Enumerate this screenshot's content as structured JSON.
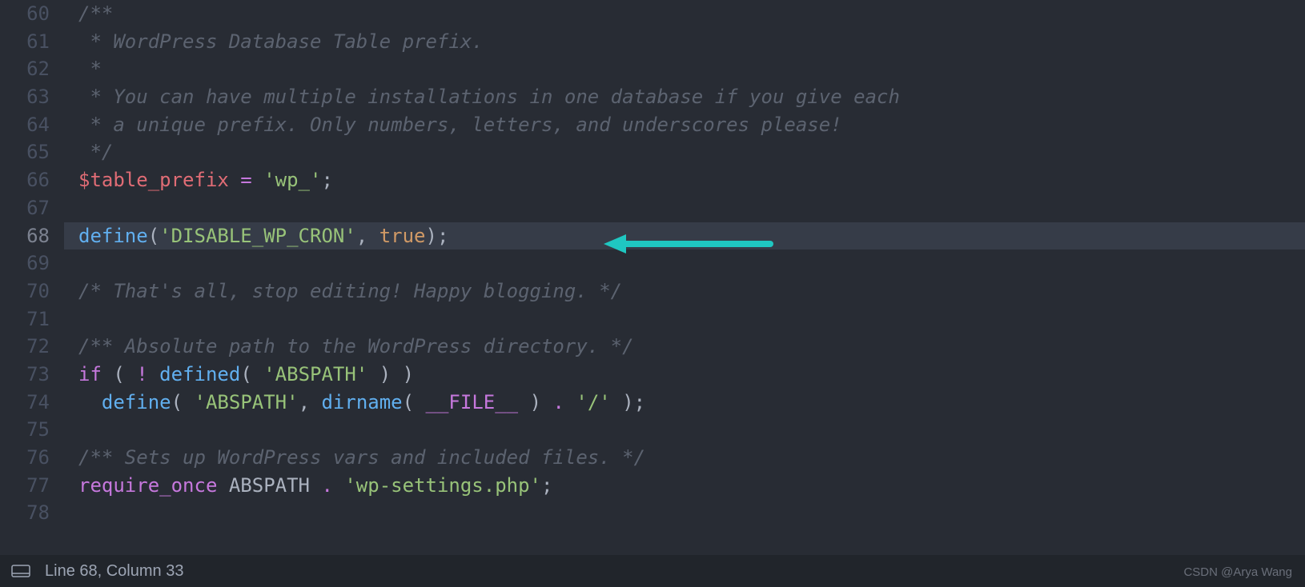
{
  "lines": [
    {
      "num": "60",
      "tokens": [
        {
          "cls": "comment",
          "text": "/**"
        }
      ]
    },
    {
      "num": "61",
      "tokens": [
        {
          "cls": "comment",
          "text": " * WordPress Database Table prefix."
        }
      ]
    },
    {
      "num": "62",
      "tokens": [
        {
          "cls": "comment",
          "text": " *"
        }
      ]
    },
    {
      "num": "63",
      "tokens": [
        {
          "cls": "comment",
          "text": " * You can have multiple installations in one database if you give each"
        }
      ]
    },
    {
      "num": "64",
      "tokens": [
        {
          "cls": "comment",
          "text": " * a unique prefix. Only numbers, letters, and underscores please!"
        }
      ]
    },
    {
      "num": "65",
      "tokens": [
        {
          "cls": "comment",
          "text": " */"
        }
      ]
    },
    {
      "num": "66",
      "tokens": [
        {
          "cls": "variable",
          "text": "$table_prefix"
        },
        {
          "cls": "default",
          "text": " "
        },
        {
          "cls": "keyword",
          "text": "="
        },
        {
          "cls": "default",
          "text": " "
        },
        {
          "cls": "string",
          "text": "'wp_'"
        },
        {
          "cls": "punct",
          "text": ";"
        }
      ]
    },
    {
      "num": "67",
      "tokens": []
    },
    {
      "num": "68",
      "highlighted": true,
      "tokens": [
        {
          "cls": "function-call",
          "text": "define"
        },
        {
          "cls": "punct",
          "text": "("
        },
        {
          "cls": "string",
          "text": "'DISABLE_WP_CRON'"
        },
        {
          "cls": "punct",
          "text": ", "
        },
        {
          "cls": "constant",
          "text": "true"
        },
        {
          "cls": "punct",
          "text": ");"
        }
      ]
    },
    {
      "num": "69",
      "tokens": []
    },
    {
      "num": "70",
      "tokens": [
        {
          "cls": "comment",
          "text": "/* That's all, stop editing! Happy blogging. */"
        }
      ]
    },
    {
      "num": "71",
      "tokens": []
    },
    {
      "num": "72",
      "tokens": [
        {
          "cls": "comment",
          "text": "/** Absolute path to the WordPress directory. */"
        }
      ]
    },
    {
      "num": "73",
      "tokens": [
        {
          "cls": "keyword",
          "text": "if"
        },
        {
          "cls": "default",
          "text": " "
        },
        {
          "cls": "punct",
          "text": "( "
        },
        {
          "cls": "keyword",
          "text": "!"
        },
        {
          "cls": "default",
          "text": " "
        },
        {
          "cls": "function-call",
          "text": "defined"
        },
        {
          "cls": "punct",
          "text": "( "
        },
        {
          "cls": "string",
          "text": "'ABSPATH'"
        },
        {
          "cls": "punct",
          "text": " ) )"
        }
      ]
    },
    {
      "num": "74",
      "tokens": [
        {
          "cls": "default",
          "text": "  "
        },
        {
          "cls": "function-call",
          "text": "define"
        },
        {
          "cls": "punct",
          "text": "( "
        },
        {
          "cls": "string",
          "text": "'ABSPATH'"
        },
        {
          "cls": "punct",
          "text": ", "
        },
        {
          "cls": "function-call",
          "text": "dirname"
        },
        {
          "cls": "punct",
          "text": "( "
        },
        {
          "cls": "constant-magic",
          "text": "__FILE__"
        },
        {
          "cls": "punct",
          "text": " ) "
        },
        {
          "cls": "keyword",
          "text": "."
        },
        {
          "cls": "punct",
          "text": " "
        },
        {
          "cls": "string",
          "text": "'/'"
        },
        {
          "cls": "punct",
          "text": " );"
        }
      ]
    },
    {
      "num": "75",
      "tokens": []
    },
    {
      "num": "76",
      "tokens": [
        {
          "cls": "comment",
          "text": "/** Sets up WordPress vars and included files. */"
        }
      ]
    },
    {
      "num": "77",
      "tokens": [
        {
          "cls": "keyword",
          "text": "require_once"
        },
        {
          "cls": "default",
          "text": " "
        },
        {
          "cls": "default",
          "text": "ABSPATH"
        },
        {
          "cls": "default",
          "text": " "
        },
        {
          "cls": "keyword",
          "text": "."
        },
        {
          "cls": "default",
          "text": " "
        },
        {
          "cls": "string",
          "text": "'wp-settings.php'"
        },
        {
          "cls": "punct",
          "text": ";"
        }
      ]
    },
    {
      "num": "78",
      "tokens": []
    }
  ],
  "status": {
    "position": "Line 68, Column 33"
  },
  "watermark": "CSDN @Arya Wang",
  "arrow": {
    "color": "#1fc7c1"
  }
}
